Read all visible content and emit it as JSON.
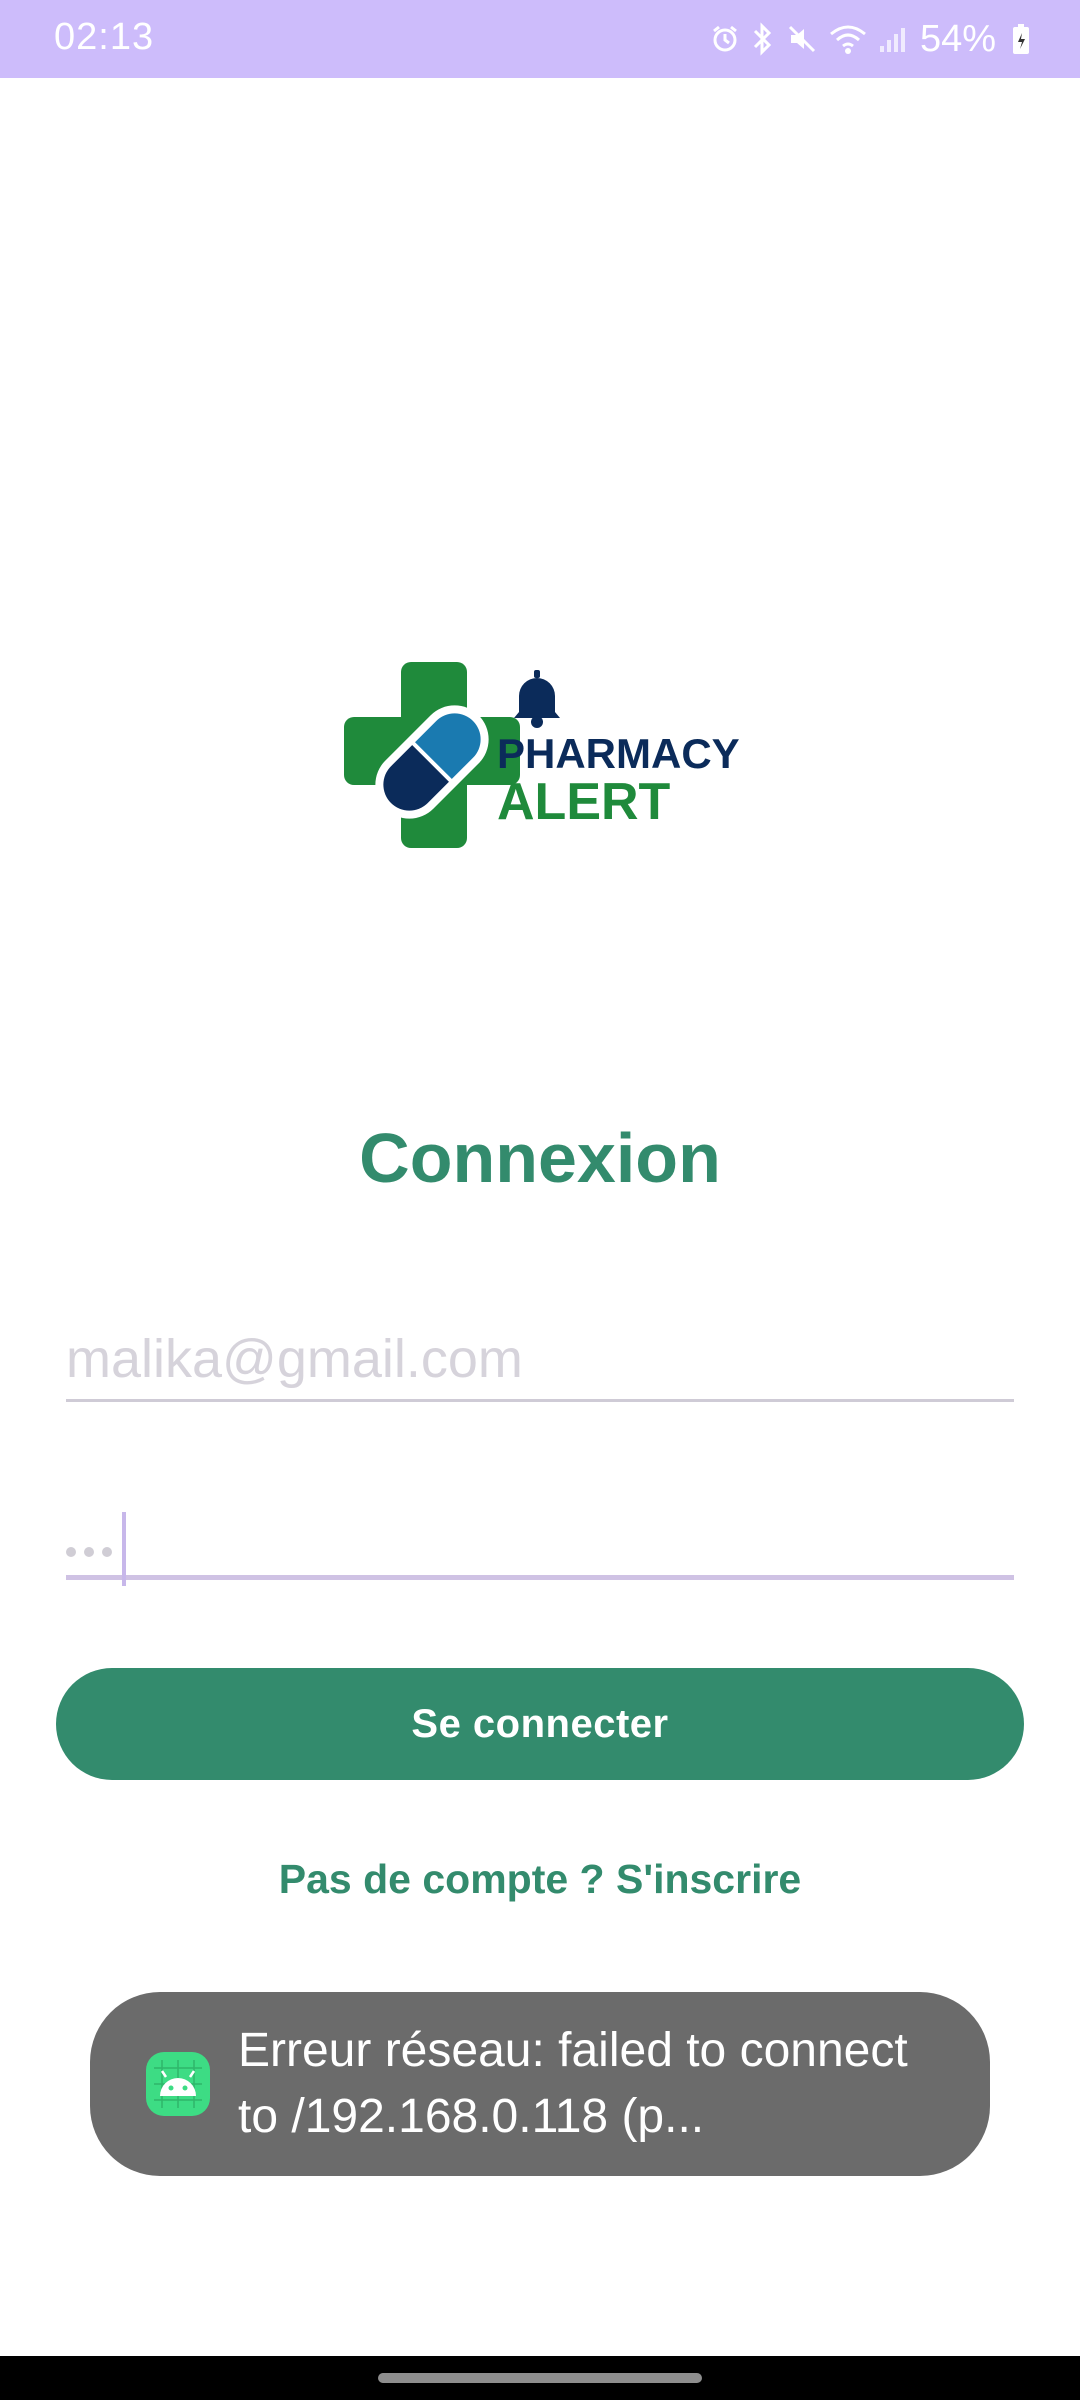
{
  "status_bar": {
    "time": "02:13",
    "battery_percent": "54%",
    "icons": [
      "alarm-icon",
      "bluetooth-icon",
      "mute-icon",
      "wifi-icon",
      "signal-icon",
      "battery-icon"
    ]
  },
  "logo": {
    "line1": "PHARMACY",
    "line2": "ALERT",
    "colors": {
      "green": "#1f8a3b",
      "navy": "#0b2b5a",
      "blue": "#1a7ab0"
    }
  },
  "login": {
    "title": "Connexion",
    "email_value": "malika@gmail.com",
    "password_masked": "•••",
    "submit_label": "Se connecter",
    "signup_link": "Pas de compte ? S'inscrire"
  },
  "toast": {
    "message": "Erreur réseau: failed to connect to /192.168.0.118 (p..."
  },
  "colors": {
    "accent": "#338b6d",
    "status_bar": "#cdbcfb",
    "toast_bg": "#6b6b6b"
  }
}
